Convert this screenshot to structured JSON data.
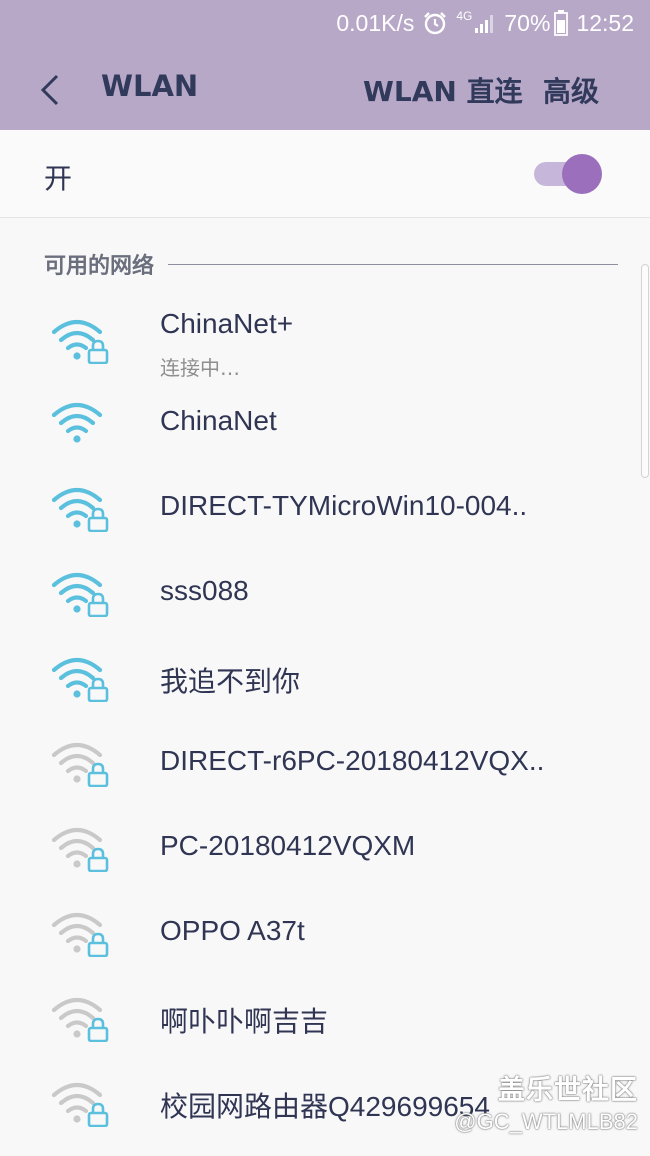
{
  "status_bar": {
    "net_speed": "0.01K/s",
    "network_type": "4G",
    "battery": "70%",
    "time": "12:52",
    "icons": [
      "alarm-icon",
      "signal-icon",
      "battery-icon"
    ]
  },
  "app_bar": {
    "title": "WLAN",
    "actions": [
      "WLAN 直连",
      "高级"
    ],
    "background": "#b7a8c8"
  },
  "toggle": {
    "label": "开",
    "state": "on",
    "accent": "#9b6fbb"
  },
  "section": {
    "title": "可用的网络"
  },
  "networks": [
    {
      "name": "ChinaNet+",
      "status": "连接中…",
      "signal": "strong",
      "secured": true
    },
    {
      "name": "ChinaNet",
      "signal": "strong",
      "secured": false
    },
    {
      "name": "DIRECT-TYMicroWin10-004..",
      "signal": "strong",
      "secured": true
    },
    {
      "name": "sss088",
      "signal": "strong",
      "secured": true
    },
    {
      "name": "我追不到你",
      "signal": "strong",
      "secured": true
    },
    {
      "name": "DIRECT-r6PC-20180412VQX..",
      "signal": "weak",
      "secured": true
    },
    {
      "name": "PC-20180412VQXM",
      "signal": "weak",
      "secured": true
    },
    {
      "name": "OPPO A37t",
      "signal": "weak",
      "secured": true
    },
    {
      "name": "啊卟卟啊吉吉",
      "signal": "weak",
      "secured": true
    },
    {
      "name": "校园网路由器Q429699654",
      "signal": "weak",
      "secured": true
    }
  ],
  "colors": {
    "wifi_strong": "#5bc0de",
    "wifi_weak": "#c9c9c9",
    "lock": "#5bc0de"
  },
  "watermark": {
    "line1": "盖乐世社区",
    "line2": "@GC_WTLMLB82"
  }
}
